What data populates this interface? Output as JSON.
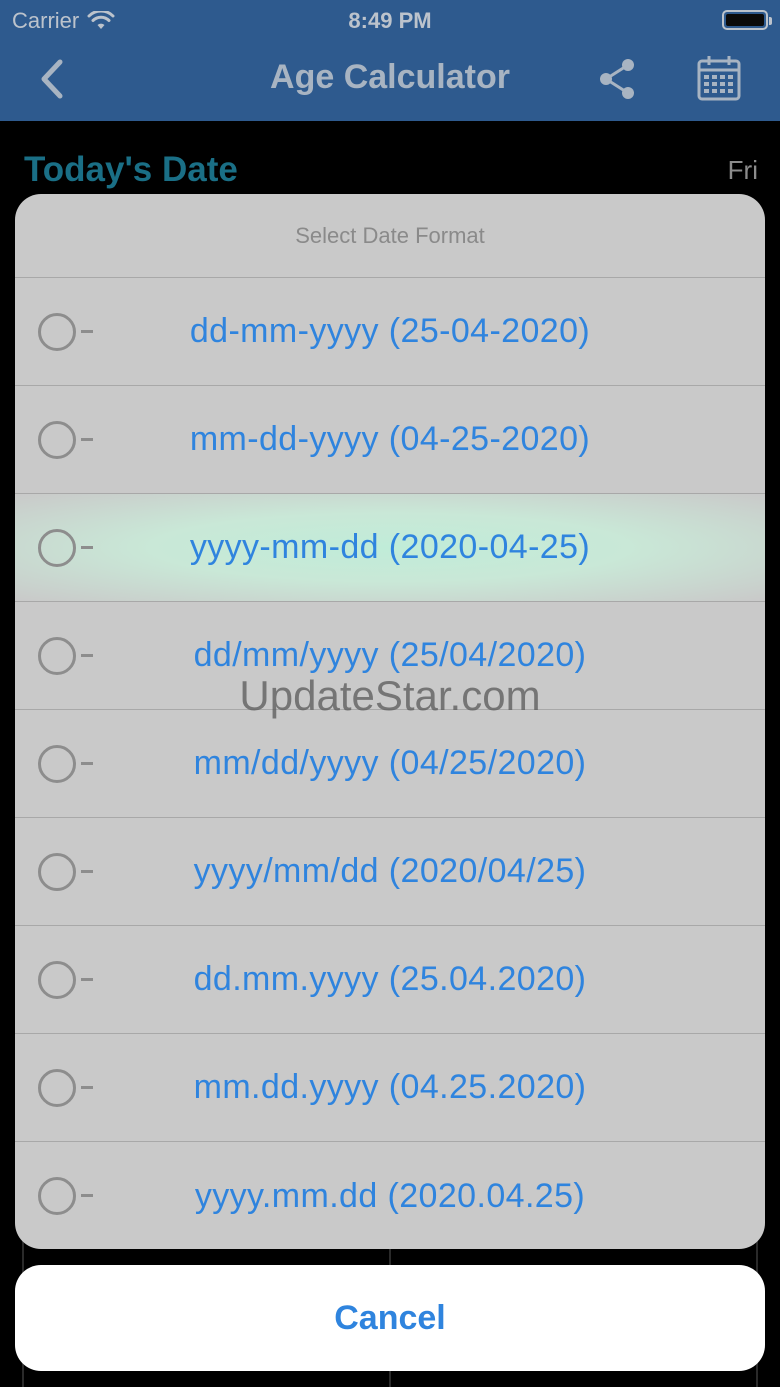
{
  "status_bar": {
    "carrier": "Carrier",
    "time": "8:49 PM"
  },
  "nav": {
    "title": "Age Calculator"
  },
  "background": {
    "section_title": "Today's Date",
    "day": "Fri"
  },
  "sheet": {
    "title": "Select Date Format",
    "options": [
      {
        "label": "dd-mm-yyyy (25-04-2020)"
      },
      {
        "label": "mm-dd-yyyy (04-25-2020)"
      },
      {
        "label": "yyyy-mm-dd (2020-04-25)"
      },
      {
        "label": "dd/mm/yyyy (25/04/2020)"
      },
      {
        "label": "mm/dd/yyyy (04/25/2020)"
      },
      {
        "label": "yyyy/mm/dd (2020/04/25)"
      },
      {
        "label": "dd.mm.yyyy (25.04.2020)"
      },
      {
        "label": "mm.dd.yyyy (04.25.2020)"
      },
      {
        "label": "yyyy.mm.dd (2020.04.25)"
      }
    ],
    "cancel_label": "Cancel"
  },
  "watermark": "UpdateStar.com",
  "colors": {
    "nav_bg": "#2e5a8e",
    "accent": "#2f84de",
    "sheet_bg": "#c9c9c9",
    "highlight": "#c0ecd8"
  }
}
